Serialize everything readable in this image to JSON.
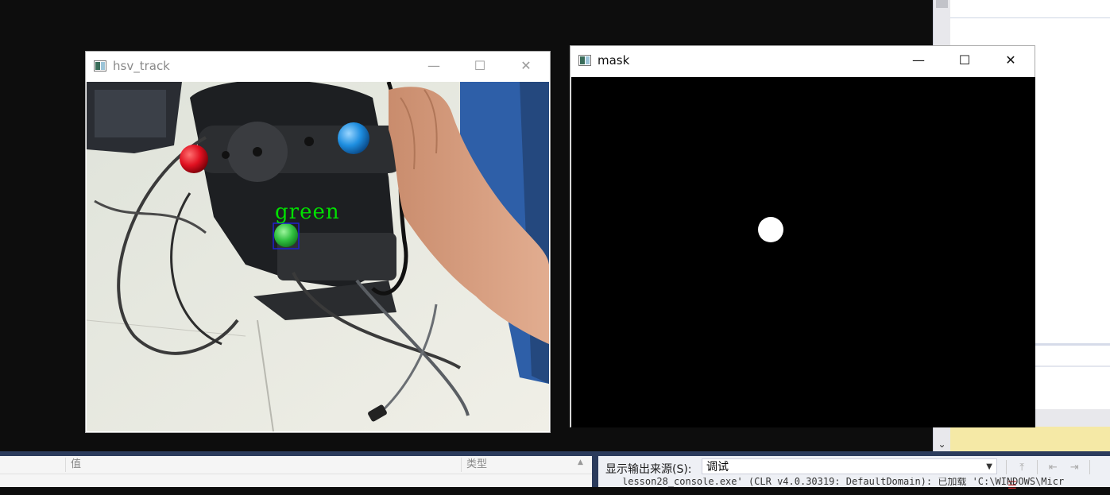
{
  "windows": {
    "track": {
      "title": "hsv_track",
      "detection_label": "green"
    },
    "mask": {
      "title": "mask"
    }
  },
  "property_panel": {
    "columns": [
      "值",
      "类型"
    ]
  },
  "output_panel": {
    "source_label": "显示输出来源(S):",
    "source_value": "调试",
    "log_line": "lesson28_console.exe' (CLR v4.0.30319: DefaultDomain): 已加载 'C:\\WINDOWS\\Micr"
  },
  "colors": {
    "ide_accent": "#2b3b5c",
    "detection_box": "#2020d0",
    "detection_text": "#00e000",
    "ball_red": "#e01020",
    "ball_blue": "#1e8ee0",
    "ball_green": "#30c040"
  }
}
